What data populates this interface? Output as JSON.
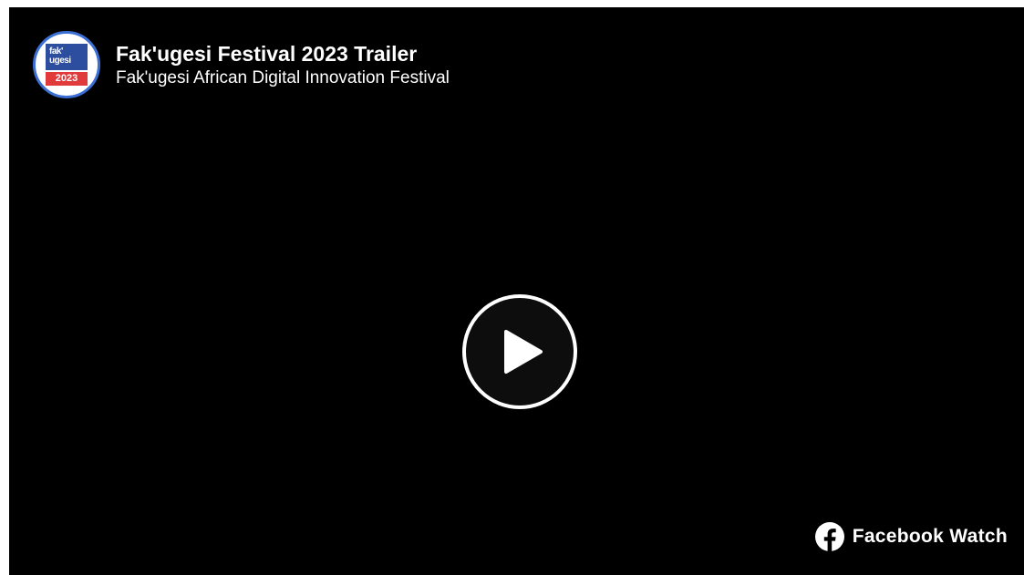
{
  "video": {
    "title": "Fak'ugesi Festival 2023 Trailer",
    "channel_name": "Fak'ugesi African Digital Innovation Festival"
  },
  "avatar": {
    "logo_text": "fak'\nugesi",
    "logo_year": "2023",
    "icon": "channel-logo-icon"
  },
  "controls": {
    "play_icon": "play-icon"
  },
  "branding": {
    "label": "Facebook Watch",
    "icon": "facebook-icon"
  },
  "colors": {
    "background": "#000000",
    "text": "#ffffff",
    "avatar_ring": "#3b6fd4",
    "logo_blue": "#2d4e9e",
    "logo_red": "#e03a3a"
  }
}
